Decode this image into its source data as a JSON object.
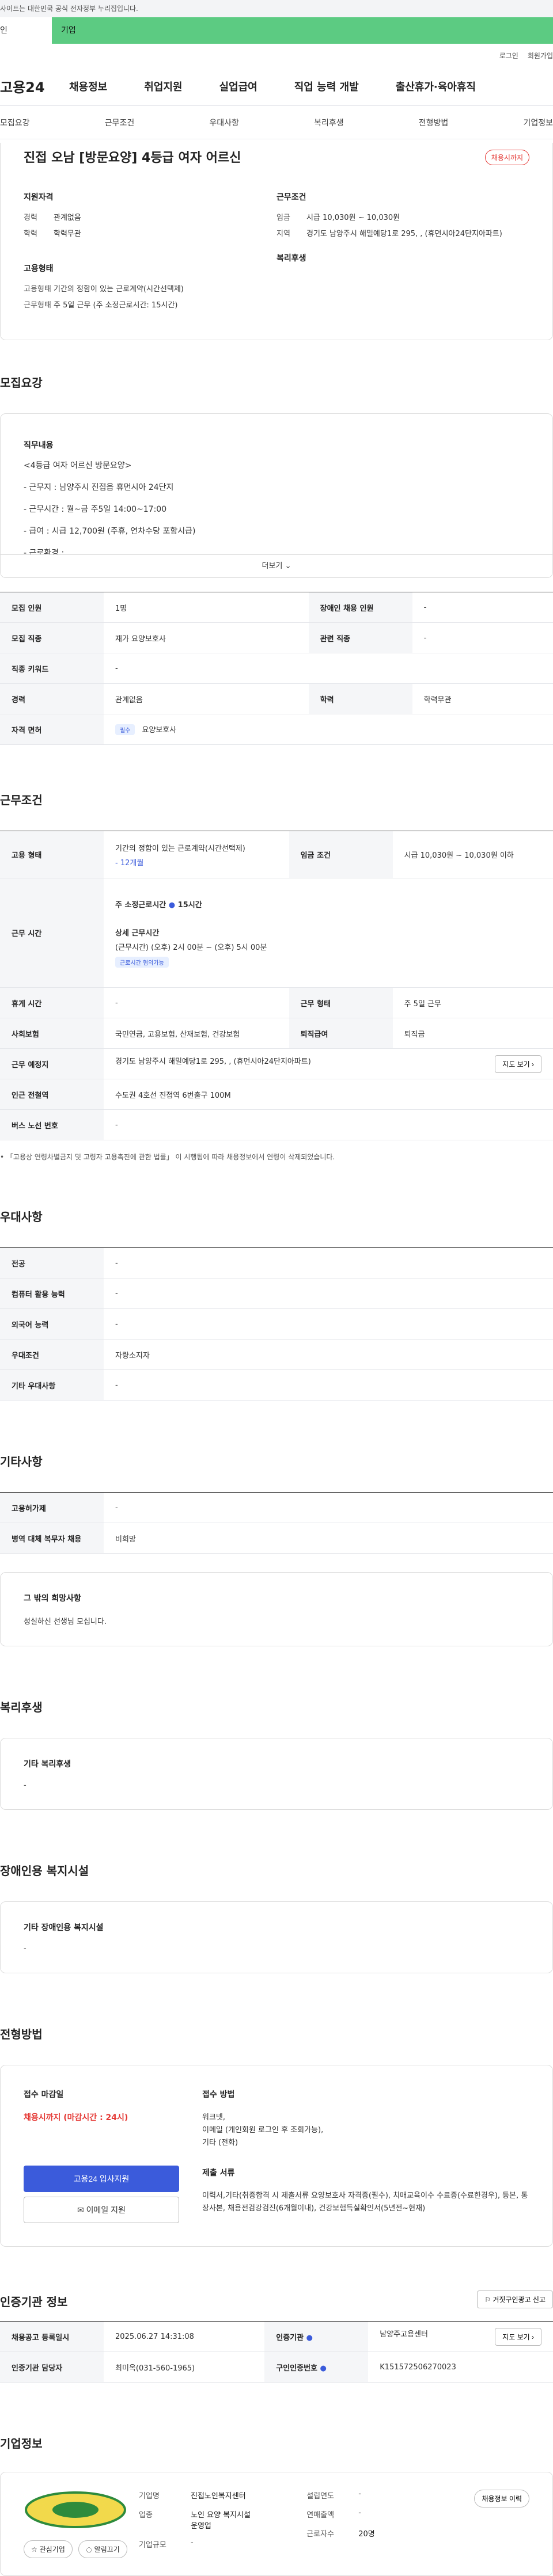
{
  "gov_notice": "사이트는 대한민국 공식 전자정부 누리집입니다.",
  "type_tabs": [
    "인",
    "기업"
  ],
  "util": {
    "login": "로그인",
    "join": "회원가입"
  },
  "logo": "고용24",
  "gnb": [
    "채용정보",
    "취업지원",
    "실업급여",
    "직업 능력 개발",
    "출산휴가·육아휴직"
  ],
  "anchors": [
    "모집요강",
    "근무조건",
    "우대사항",
    "복리후생",
    "전형방법",
    "기업정보"
  ],
  "header": {
    "title": "진접 오남 [방문요양] 4등급 여자 어르신",
    "status_badge": "채용시까지",
    "qual_title": "지원자격",
    "qual": [
      {
        "k": "경력",
        "v": "관계없음"
      },
      {
        "k": "학력",
        "v": "학력무관"
      }
    ],
    "emp_title": "고용형태",
    "emp": [
      {
        "k": "고용형태",
        "v": "기간의 정함이 있는 근로계약(시간선택제)"
      },
      {
        "k": "근무형태",
        "v": "주 5일 근무 (주 소정근로시간: 15시간)"
      }
    ],
    "cond_title": "근무조건",
    "cond": [
      {
        "k": "임금",
        "v": "시급 10,030원 ~ 10,030원"
      },
      {
        "k": "지역",
        "v": "경기도 남양주시 해밀예당1로 295, , (휴먼시아24단지아파트)"
      }
    ],
    "welfare_title": "복리후생"
  },
  "recruit": {
    "section": "모집요강",
    "box_title": "직무내용",
    "lines": [
      "<4등급 여자 어르신 방문요양>",
      "- 근무지 : 남양주시 진접읍 휴먼시아 24단지",
      "- 근무시간 : 월~금 주5일 14:00~17:00",
      "- 급여 : 시급 12,700원 (주휴, 연차수당 포함시급)",
      "- 근로환경 :"
    ],
    "more": "더보기",
    "rows": [
      [
        {
          "k": "모집 인원",
          "v": "1명"
        },
        {
          "k": "장애인 채용 인원",
          "v": "-"
        }
      ],
      [
        {
          "k": "모집 직종",
          "v": "재가 요양보호사"
        },
        {
          "k": "관련 직종",
          "v": "-"
        }
      ],
      [
        {
          "k": "직종 키워드",
          "v": "-"
        }
      ],
      [
        {
          "k": "경력",
          "v": "관계없음"
        },
        {
          "k": "학력",
          "v": "학력무관"
        }
      ],
      [
        {
          "k": "자격 면허",
          "v": "요양보호사",
          "tag": "필수"
        }
      ]
    ]
  },
  "work": {
    "section": "근무조건",
    "emp_type_k": "고용 형태",
    "emp_type_v": "기간의 정함이 있는 근로계약(시간선택제)",
    "emp_period": "- 12개월",
    "wage_k": "임금 조건",
    "wage_v": "시급 10,030원 ~ 10,030원 이하",
    "hours_k": "근무 시간",
    "hours_main": "주 소정근로시간",
    "hours_main_v": "15시간",
    "hours_detail_t": "상세 근무시간",
    "hours_detail_v": "(근무시간) (오후) 2시 00분 ~ (오후) 5시 00분",
    "hours_tag": "근로시간 협의가능",
    "break_k": "휴게 시간",
    "break_v": "-",
    "type_k": "근무 형태",
    "type_v": "주 5일 근무",
    "insure_k": "사회보험",
    "insure_v": "국민연금, 고용보험, 산재보험, 건강보험",
    "retire_k": "퇴직급여",
    "retire_v": "퇴직금",
    "place_k": "근무 예정지",
    "place_v": "경기도 남양주시 해밀예당1로 295, , (휴먼시아24단지아파트)",
    "map_btn": "지도 보기",
    "subway_k": "인근 전철역",
    "subway_v": "수도권 4호선 진접역 6번출구 100M",
    "bus_k": "버스 노선 번호",
    "bus_v": "-",
    "note": "「고용상 연령차별금지 및 고령자 고용촉진에 관한 법률」 이 시행됨에 따라 채용정보에서 연령이 삭제되었습니다."
  },
  "pref": {
    "section": "우대사항",
    "rows": [
      {
        "k": "전공",
        "v": "-"
      },
      {
        "k": "컴퓨터 활용 능력",
        "v": "-"
      },
      {
        "k": "외국어 능력",
        "v": "-"
      },
      {
        "k": "우대조건",
        "v": "자량소지자"
      },
      {
        "k": "기타 우대사항",
        "v": "-"
      }
    ]
  },
  "etc": {
    "section": "기타사항",
    "rows": [
      {
        "k": "고용허가제",
        "v": "-"
      },
      {
        "k": "병역 대체 복무자 채용",
        "v": "비희망"
      }
    ],
    "box_title": "그 밖의 희망사항",
    "box_v": "성실하신 선생님 모십니다."
  },
  "welfare": {
    "section": "복리후생",
    "box_title": "기타 복리후생",
    "box_v": "-"
  },
  "disab": {
    "section": "장애인용 복지시설",
    "box_title": "기타 장애인용 복지시설",
    "box_v": "-"
  },
  "process": {
    "section": "전형방법",
    "deadline_t": "접수 마감일",
    "deadline_v": "채용시까지 (마감시간 : 24시)",
    "method_t": "접수 방법",
    "method_v": [
      "워크넷,",
      "이메일 (개인회원 로그인 후 조회가능),",
      "기타 (전화)"
    ],
    "docs_t": "제출 서류",
    "docs_v": "이력서,기타(취증합격 시 제출서류 요양보호사 자격증(필수), 치매교육이수 수료증(수료한경우), 등본, 통장사본, 채용전검강검진(6개월이내), 건강보험득실확인서(5년전~현재)",
    "apply_btn": "고용24 입사지원",
    "email_btn": "이메일 지원"
  },
  "cert": {
    "section": "인증기관 정보",
    "report_btn": "거짓구인광고 신고",
    "reg_k": "채용공고 등록일시",
    "reg_v": "2025.06.27 14:31:08",
    "org_k": "인증기관",
    "org_v": "남양주고용센터",
    "map_btn": "지도 보기",
    "mgr_k": "인증기관 담당자",
    "mgr_v": "최미옥(031-560-1965)",
    "id_k": "구인인증번호",
    "id_v": "K151572506270023"
  },
  "company": {
    "section": "기업정보",
    "fav_btn": "관심기업",
    "alarm_btn": "알림끄기",
    "name_k": "기업명",
    "name_v": "진접노인복지센터",
    "ind_k": "업종",
    "ind_v": "노인 요양 복지시설 운영업",
    "size_k": "기업규모",
    "size_v": "-",
    "est_k": "설립연도",
    "est_v": "-",
    "sales_k": "연매출액",
    "sales_v": "-",
    "emp_k": "근로자수",
    "emp_v": "20명",
    "jobs_btn": "채용정보 이력"
  }
}
